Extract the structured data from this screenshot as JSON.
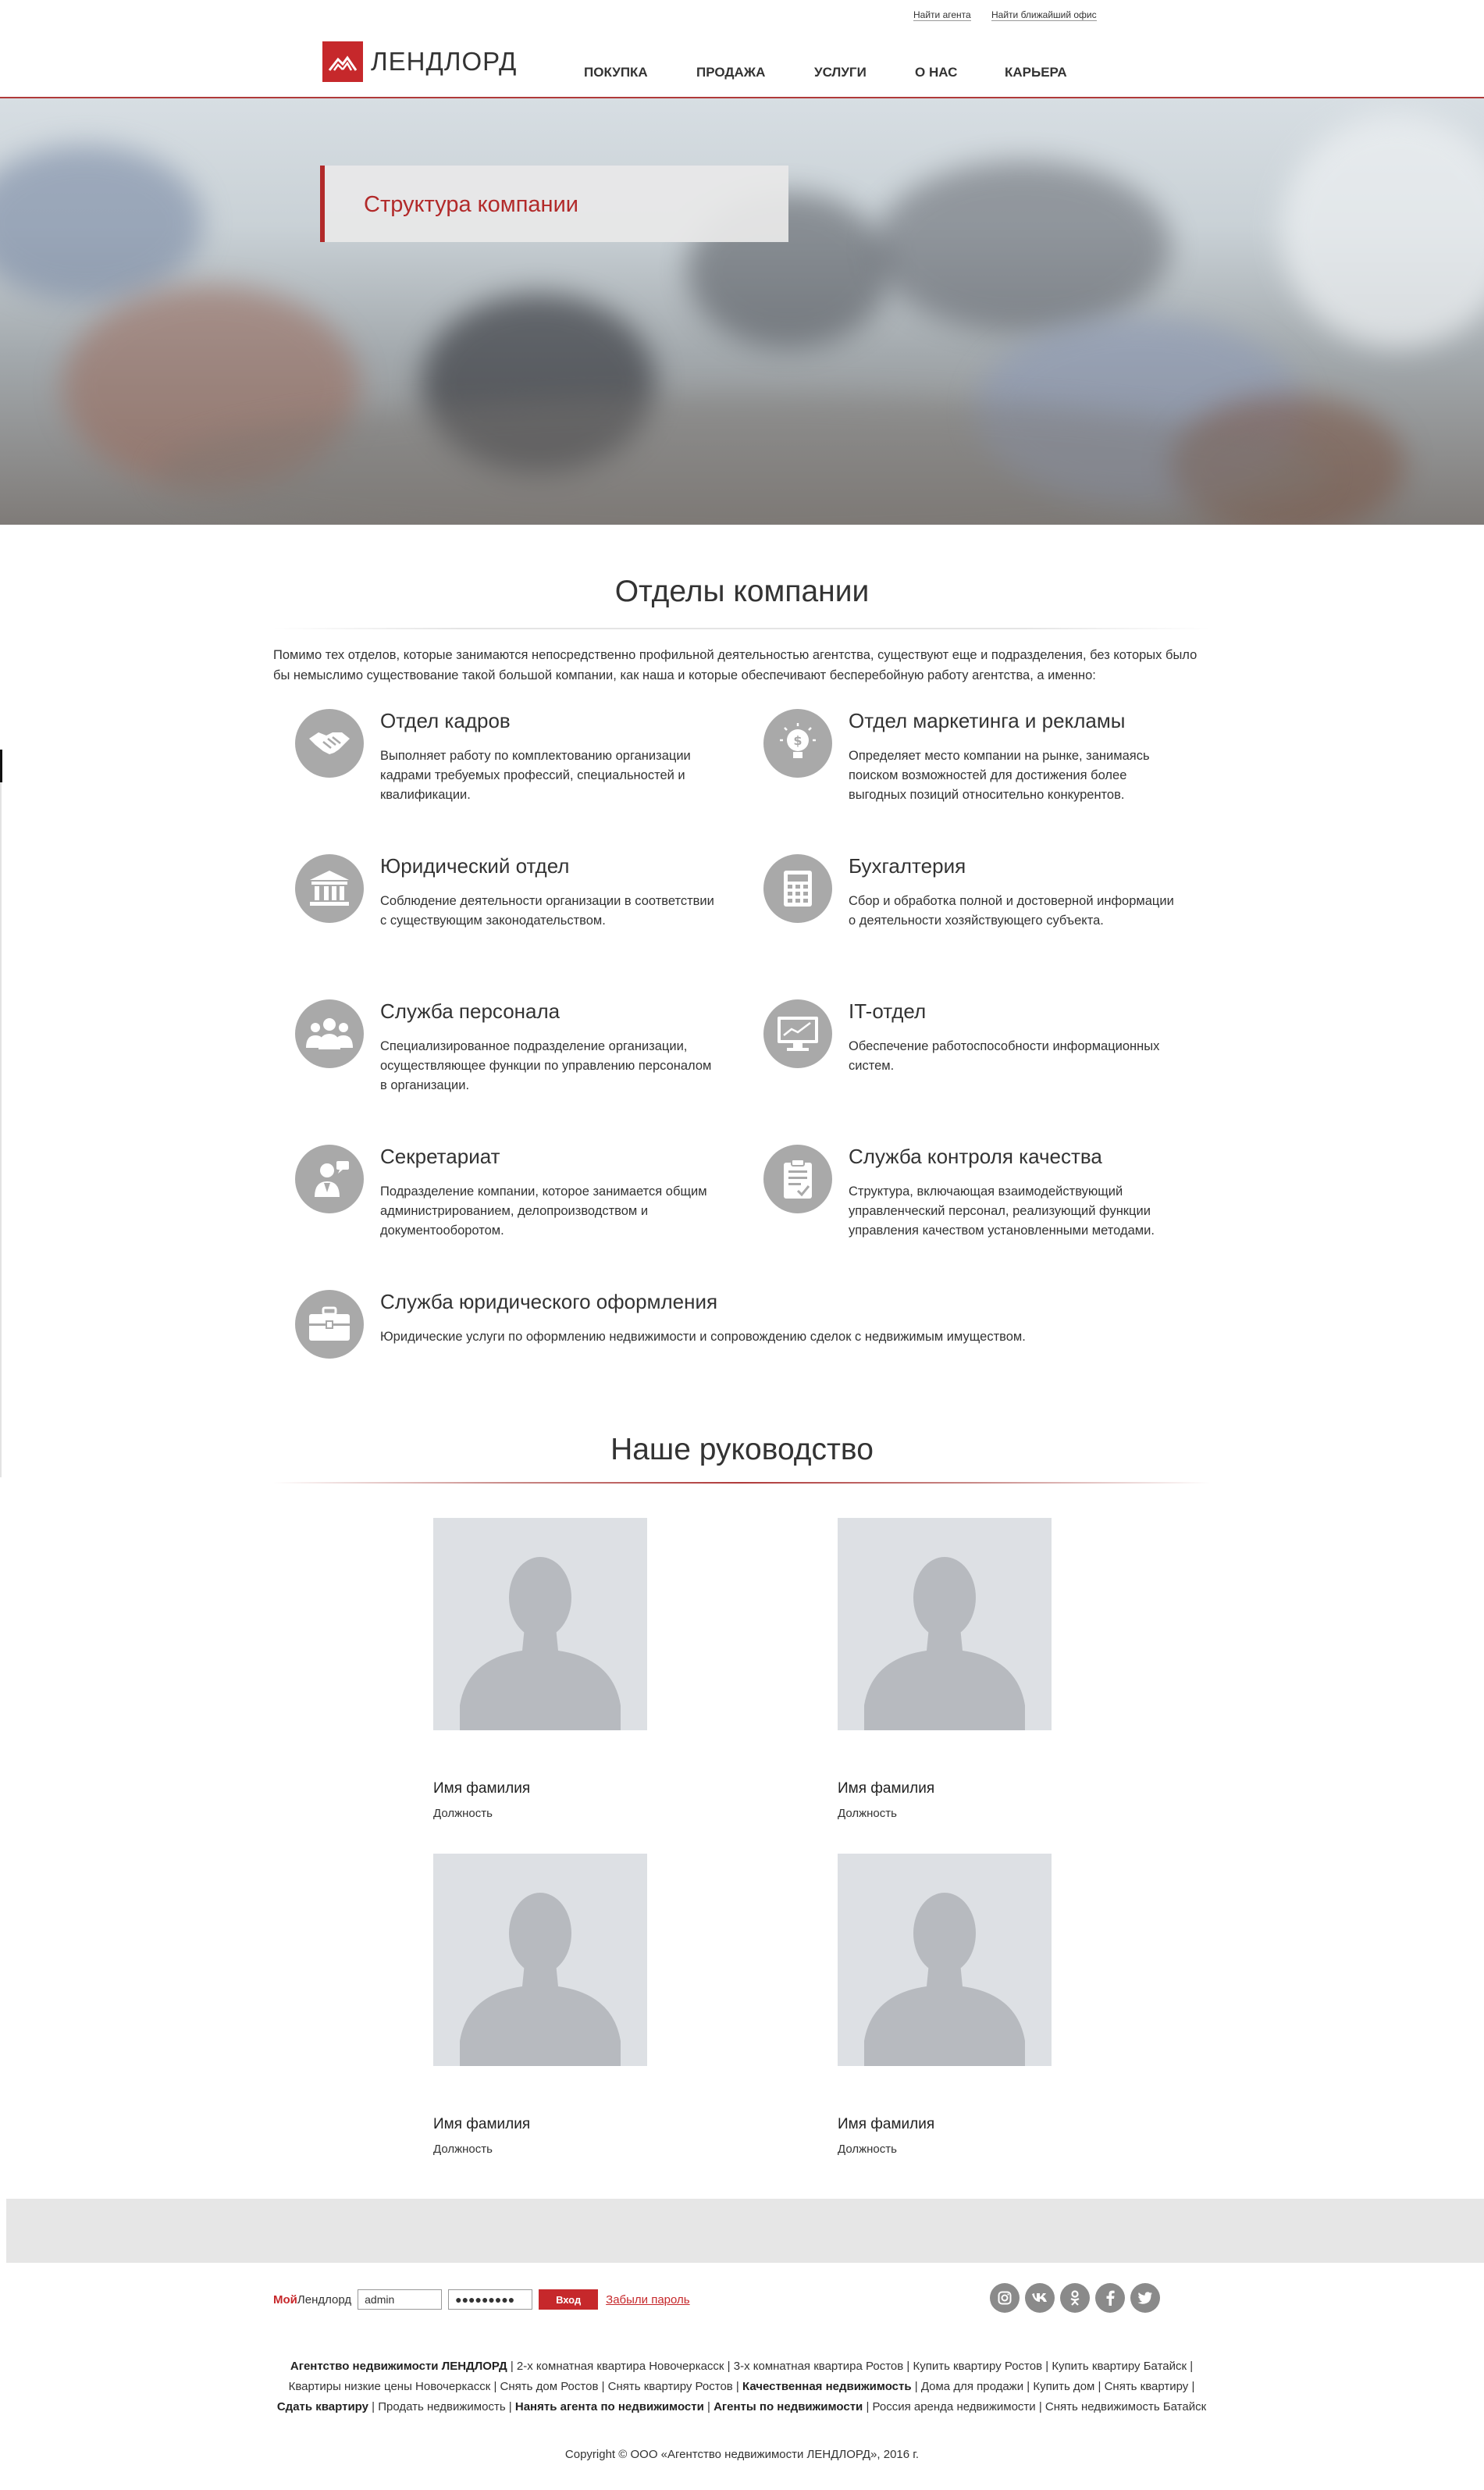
{
  "topbar": {
    "find_agent": "Найти агента",
    "find_office": "Найти ближайший офис"
  },
  "logo": {
    "text": "ЛЕНДЛОРД",
    "icon": "house-roof-icon",
    "color": "#c6282b"
  },
  "nav": [
    "ПОКУПКА",
    "ПРОДАЖА",
    "УСЛУГИ",
    "О НАС",
    "КАРЬЕРА"
  ],
  "hero": {
    "title": "Структура компании"
  },
  "departments_section": {
    "title": "Отделы компании",
    "intro": "Помимо тех отделов, которые занимаются непосредственно профильной деятельностью агентства, существуют еще и подразделения, без которых было бы немыслимо существование такой большой компании, как наша и которые обеспечивают бесперебойную работу агентства, а именно:",
    "items": [
      {
        "name": "Отдел кадров",
        "icon": "handshake-icon",
        "desc": "Выполняет работу по комплектованию организации кадрами требуемых профессий, специальностей и квалификации."
      },
      {
        "name": "Отдел маркетинга и рекламы",
        "icon": "lightbulb-dollar-icon",
        "desc": "Определяет место компании на рынке, занимаясь поиском возможностей для достижения более выгодных позиций относительно конкурентов."
      },
      {
        "name": "Юридический отдел",
        "icon": "courthouse-icon",
        "desc": "Соблюдение деятельности организации в соответствии с существующим законодательством."
      },
      {
        "name": "Бухгалтерия",
        "icon": "calculator-icon",
        "desc": "Сбор и обработка полной и достоверной информации о деятельности хозяйствующего субъекта."
      },
      {
        "name": "Служба персонала",
        "icon": "people-group-icon",
        "desc": "Специализированное подразделение организации, осуществляющее функции по управлению персоналом в организации."
      },
      {
        "name": "IT-отдел",
        "icon": "monitor-chart-icon",
        "desc": "Обеспечение работоспособности информационных систем."
      },
      {
        "name": "Секретариат",
        "icon": "secretary-icon",
        "desc": "Подразделение компании, которое занимается общим администрированием, делопроизводством и документооборотом."
      },
      {
        "name": "Служба контроля качества",
        "icon": "clipboard-check-icon",
        "desc": "Структура, включающая взаимодействующий управленческий персонал, реализующий функции управления качеством установленными методами."
      },
      {
        "name": "Служба юридического оформления",
        "icon": "briefcase-icon",
        "desc": "Юридические услуги по оформлению недвижимости и сопровождению сделок с недвижимым имуществом."
      }
    ]
  },
  "management_section": {
    "title": "Наше руководство",
    "people": [
      {
        "name": "Имя фамилия",
        "position": "Должность"
      },
      {
        "name": "Имя фамилия",
        "position": "Должность"
      },
      {
        "name": "Имя фамилия",
        "position": "Должность"
      },
      {
        "name": "Имя фамилия",
        "position": "Должность"
      }
    ]
  },
  "footer": {
    "brand_my": "Мой",
    "brand_name": "Лендлорд",
    "login_value": "admin",
    "password_value": "●●●●●●●●●",
    "login_button": "Вход",
    "forgot": "Забыли пароль",
    "socials": [
      "instagram-icon",
      "vk-icon",
      "odnoklassniki-icon",
      "facebook-icon",
      "twitter-icon"
    ],
    "links": [
      {
        "text": "Агентство недвижимости ЛЕНДЛОРД",
        "bold": true
      },
      {
        "text": "2-х комнатная квартира Новочеркасск",
        "bold": false
      },
      {
        "text": "3-х комнатная квартира Ростов",
        "bold": false
      },
      {
        "text": "Купить квартиру Ростов",
        "bold": false
      },
      {
        "text": "Купить квартиру Батайск",
        "bold": false
      },
      {
        "text": "Квартиры низкие цены Новочеркасск",
        "bold": false
      },
      {
        "text": "Снять дом Ростов",
        "bold": false
      },
      {
        "text": "Снять квартиру Ростов",
        "bold": false
      },
      {
        "text": "Качественная недвижимость",
        "bold": true
      },
      {
        "text": "Дома для продажи",
        "bold": false
      },
      {
        "text": "Купить дом",
        "bold": false
      },
      {
        "text": "Снять квартиру",
        "bold": false
      },
      {
        "text": "Сдать квартиру",
        "bold": true
      },
      {
        "text": "Продать недвижимость",
        "bold": false
      },
      {
        "text": "Нанять агента по недвижимости",
        "bold": true
      },
      {
        "text": "Агенты по недвижимости",
        "bold": true
      },
      {
        "text": "Россия аренда недвижимости",
        "bold": false
      },
      {
        "text": "Снять недвижимость Батайск",
        "bold": false
      }
    ],
    "copyright": "Copyright © ООО «Агентство недвижимости ЛЕНДЛОРД», 2016 г."
  }
}
